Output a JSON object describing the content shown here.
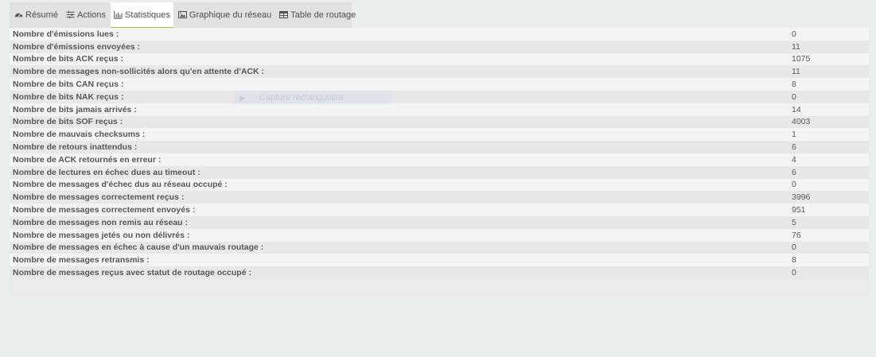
{
  "tabs": [
    {
      "id": "resume",
      "label": "Résumé",
      "icon": "dashboard-icon"
    },
    {
      "id": "actions",
      "label": "Actions",
      "icon": "sliders-icon"
    },
    {
      "id": "stats",
      "label": "Statistiques",
      "icon": "bar-chart-icon",
      "active": true
    },
    {
      "id": "graph",
      "label": "Graphique du réseau",
      "icon": "image-icon"
    },
    {
      "id": "routing",
      "label": "Table de routage",
      "icon": "table-icon"
    }
  ],
  "ghost_tooltip": "Capture rectangulaire",
  "stats": [
    {
      "label": "Nombre d'émissions lues :",
      "value": "0"
    },
    {
      "label": "Nombre d'émissions envoyées :",
      "value": "11"
    },
    {
      "label": "Nombre de bits ACK reçus :",
      "value": "1075"
    },
    {
      "label": "Nombre de messages non-sollicités alors qu'en attente d'ACK :",
      "value": "11"
    },
    {
      "label": "Nombre de bits CAN reçus :",
      "value": "8"
    },
    {
      "label": "Nombre de bits NAK reçus :",
      "value": "0"
    },
    {
      "label": "Nombre de bits jamais arrivés :",
      "value": "14"
    },
    {
      "label": "Nombre de bits SOF reçus :",
      "value": "4003"
    },
    {
      "label": "Nombre de mauvais checksums :",
      "value": "1"
    },
    {
      "label": "Nombre de retours inattendus :",
      "value": "6"
    },
    {
      "label": "Nombre de ACK retournés en erreur :",
      "value": "4"
    },
    {
      "label": "Nombre de lectures en échec dues au timeout :",
      "value": "6"
    },
    {
      "label": "Nombre de messages d'échec dus au réseau occupé :",
      "value": "0"
    },
    {
      "label": "Nombre de messages correctement reçus :",
      "value": "3996"
    },
    {
      "label": "Nombre de messages correctement envoyés :",
      "value": "951"
    },
    {
      "label": "Nombre de messages non remis au réseau :",
      "value": "5"
    },
    {
      "label": "Nombre de messages jetés ou non délivrés :",
      "value": "76"
    },
    {
      "label": "Nombre de messages en échec à cause d'un mauvais routage :",
      "value": "0"
    },
    {
      "label": "Nombre de messages retransmis :",
      "value": "8"
    },
    {
      "label": "Nombre de messages reçus avec statut de routage occupé :",
      "value": "0"
    }
  ]
}
